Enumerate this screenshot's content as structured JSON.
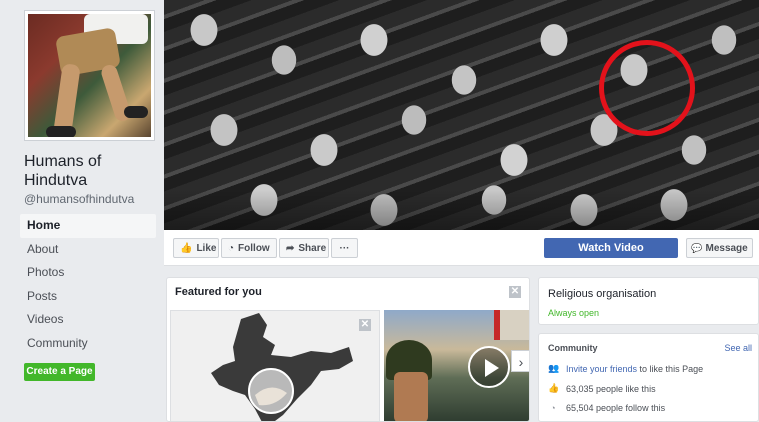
{
  "page": {
    "name": "Humans of Hindutva",
    "handle": "@humansofhindutva"
  },
  "sidebar": {
    "items": [
      {
        "label": "Home",
        "active": true
      },
      {
        "label": "About"
      },
      {
        "label": "Photos"
      },
      {
        "label": "Posts"
      },
      {
        "label": "Videos"
      },
      {
        "label": "Community"
      }
    ],
    "create_page": "Create a Page"
  },
  "actions": {
    "like": "Like",
    "follow": "Follow",
    "share": "Share",
    "more": "···",
    "watch_video": "Watch Video",
    "message": "Message"
  },
  "featured": {
    "title": "Featured for you",
    "close": "✕"
  },
  "about": {
    "category": "Religious organisation",
    "status": "Always open"
  },
  "community": {
    "title": "Community",
    "see_all": "See all",
    "invite_link": "Invite your friends",
    "invite_rest": " to like this Page",
    "likes": "63,035 people like this",
    "follows": "65,504 people follow this"
  },
  "colors": {
    "primary": "#4267b2",
    "green": "#42b72a",
    "highlight": "#e3121b"
  },
  "icons": {
    "like": "thumbs-up-icon",
    "follow": "rss-icon",
    "share": "share-arrow-icon",
    "message": "messenger-icon",
    "invite": "people-icon",
    "likes": "thumbs-up-icon",
    "follows": "rss-icon"
  }
}
